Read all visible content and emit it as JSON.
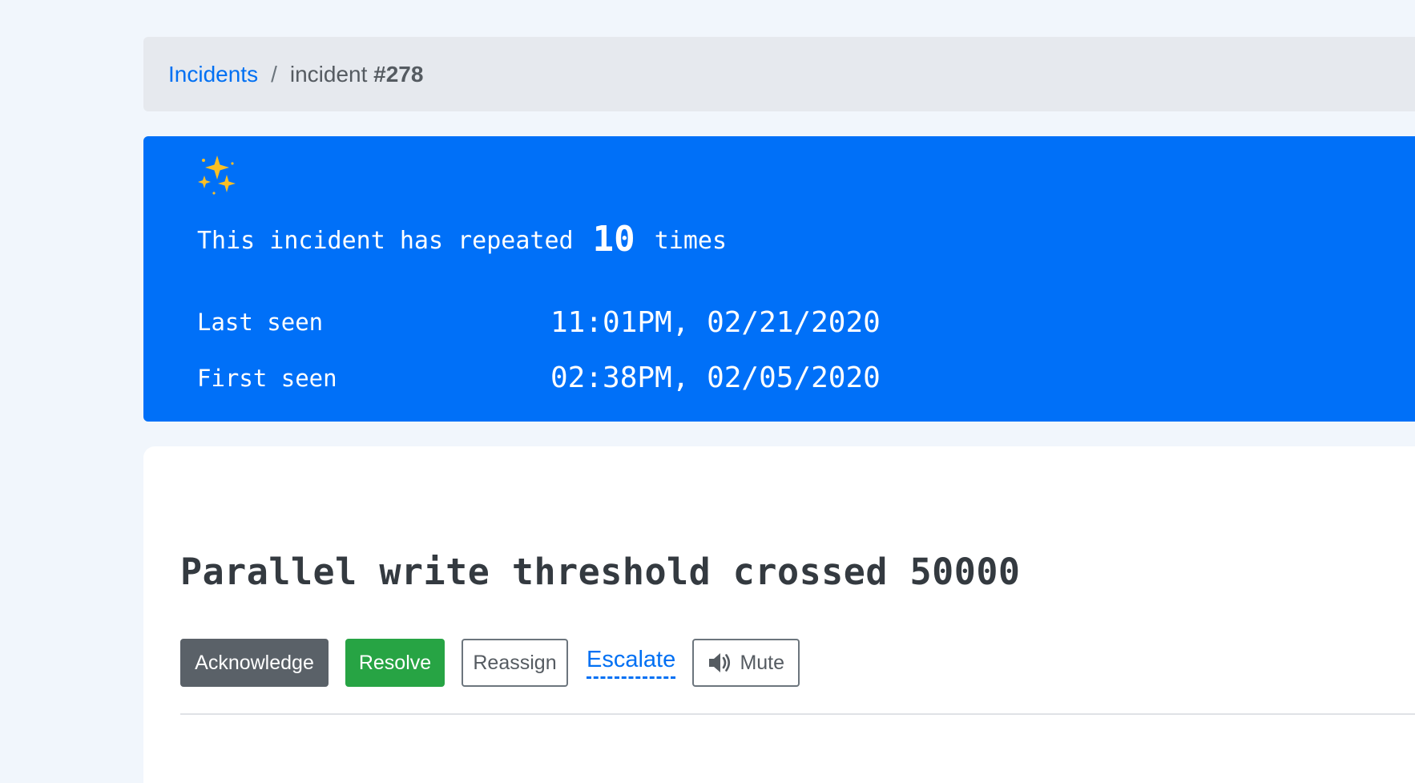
{
  "breadcrumb": {
    "parent_label": "Incidents",
    "separator": "/",
    "current_prefix": "incident",
    "current_id": "#278"
  },
  "banner": {
    "icon": "sparkles-icon",
    "repeat_prefix": "This incident has repeated",
    "repeat_count": "10",
    "repeat_suffix": "times",
    "last_seen_label": "Last seen",
    "last_seen_value": "11:01PM, 02/21/2020",
    "first_seen_label": "First seen",
    "first_seen_value": "02:38PM, 02/05/2020"
  },
  "incident": {
    "title": "Parallel write threshold crossed 50000"
  },
  "actions": {
    "acknowledge_label": "Acknowledge",
    "resolve_label": "Resolve",
    "reassign_label": "Reassign",
    "escalate_label": "Escalate",
    "mute_label": "Mute",
    "mute_icon": "speaker-icon"
  },
  "colors": {
    "page_background": "#f1f6fc",
    "breadcrumb_background": "#e6e9ee",
    "banner_background": "#0070f8",
    "link": "#0070f3",
    "acknowledge": "#5a6168",
    "resolve": "#27a444",
    "sparkle": "#fbbf24"
  }
}
